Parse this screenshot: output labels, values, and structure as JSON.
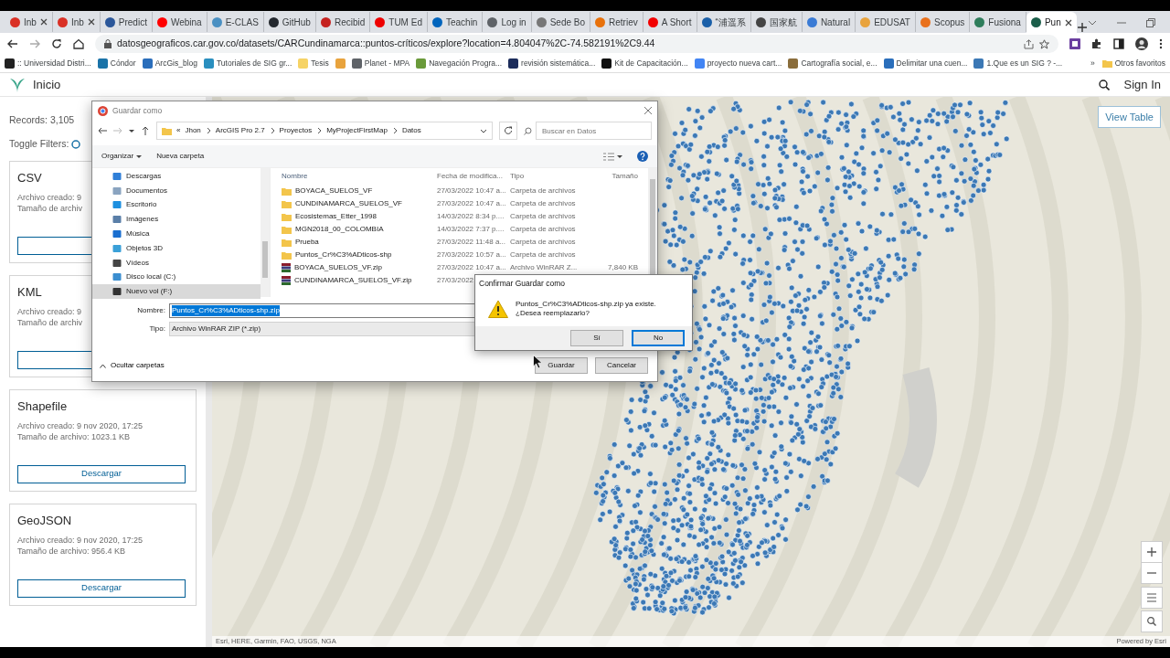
{
  "browser": {
    "tabs": [
      {
        "label": "Inb",
        "color": "#d93025",
        "closable": true,
        "selected": false
      },
      {
        "label": "Inb",
        "color": "#d93025",
        "closable": true,
        "selected": false
      },
      {
        "label": "Predict",
        "color": "#2b579a",
        "closable": false,
        "selected": false
      },
      {
        "label": "Webina",
        "color": "#ff0000",
        "closable": false,
        "selected": false
      },
      {
        "label": "E-CLAS",
        "color": "#4a90c2",
        "closable": false,
        "selected": false
      },
      {
        "label": "GitHub",
        "color": "#24292f",
        "closable": false,
        "selected": false
      },
      {
        "label": "Recibid",
        "color": "#c5221f",
        "closable": false,
        "selected": false
      },
      {
        "label": "TUM Ed",
        "color": "#ee0000",
        "closable": false,
        "selected": false
      },
      {
        "label": "Teachin",
        "color": "#0065bd",
        "closable": false,
        "selected": false
      },
      {
        "label": "Log in",
        "color": "#5f6368",
        "closable": false,
        "selected": false
      },
      {
        "label": "Sede Bo",
        "color": "#777777",
        "closable": false,
        "selected": false
      },
      {
        "label": "Retriev",
        "color": "#e8710a",
        "closable": false,
        "selected": false
      },
      {
        "label": "A Short",
        "color": "#f20000",
        "closable": false,
        "selected": false
      },
      {
        "label": "“浦遥系",
        "color": "#1a5fa8",
        "closable": false,
        "selected": false
      },
      {
        "label": "国家航",
        "color": "#444444",
        "closable": false,
        "selected": false
      },
      {
        "label": "Natural",
        "color": "#3a7bd5",
        "closable": false,
        "selected": false
      },
      {
        "label": "EDUSAT",
        "color": "#e8a33d",
        "closable": false,
        "selected": false
      },
      {
        "label": "Scopus",
        "color": "#e9711c",
        "closable": false,
        "selected": false
      },
      {
        "label": "Fusiona",
        "color": "#2e7d5b",
        "closable": false,
        "selected": false
      },
      {
        "label": "Pun",
        "color": "#1b5e4a",
        "closable": true,
        "selected": true
      }
    ],
    "address": "datosgeograficos.car.gov.co/datasets/CARCundinamarca::puntos-críticos/explore?location=4.804047%2C-74.582191%2C9.44",
    "bookmarks": [
      {
        "label": ":: Universidad Distri...",
        "color": "#222222"
      },
      {
        "label": "Cóndor",
        "color": "#1a73a8"
      },
      {
        "label": "ArcGis_blog",
        "color": "#2a6ebb"
      },
      {
        "label": "Tutoriales de SIG gr...",
        "color": "#2a8fbf"
      },
      {
        "label": "Tesis",
        "color": "#f6d365"
      },
      {
        "color": "#e8a33d"
      },
      {
        "label": "Planet - MPA",
        "color": "#5f6368"
      },
      {
        "label": "Navegación Progra...",
        "color": "#6a9a3a"
      },
      {
        "label": "revisión sistemática...",
        "color": "#1c2c5b"
      },
      {
        "label": "Kit de Capacitación...",
        "color": "#111111"
      },
      {
        "label": "proyecto nueva cart...",
        "color": "#4285f4"
      },
      {
        "label": "Cartografía social, e...",
        "color": "#8a6d3b"
      },
      {
        "label": "Delimitar una cuen...",
        "color": "#2a6ebb"
      },
      {
        "label": "1.Que es un SIG ? -...",
        "color": "#3b78b5"
      }
    ],
    "more": "»",
    "other_bookmarks": "Otros favoritos"
  },
  "site": {
    "title": "Inicio",
    "sign_in": "Sign In"
  },
  "sidebar": {
    "records": "Records: 3,105",
    "toggle_label": "Toggle Filters:",
    "toggle_on": false,
    "downloads": [
      {
        "format": "CSV",
        "lines": [
          "Archivo creado: 9",
          "Tamaño de archiv"
        ]
      },
      {
        "format": "KML",
        "lines": [
          "Archivo creado: 9",
          "Tamaño de archiv"
        ]
      },
      {
        "format": "Shapefile",
        "lines": [
          "Archivo creado: 9 nov 2020, 17:25",
          "Tamaño de archivo: 1023.1 KB"
        ],
        "button": "Descargar"
      },
      {
        "format": "GeoJSON",
        "lines": [
          "Archivo creado: 9 nov 2020, 17:25",
          "Tamaño de archivo: 956.4 KB"
        ],
        "button": "Descargar"
      }
    ]
  },
  "map": {
    "view_table": "View Table",
    "attribution": "Esri, HERE, Garmin, FAO, USGS, NGA",
    "powered": "Powered by Esri"
  },
  "save_dialog": {
    "title": "Guardar como",
    "overflow": "«",
    "path": [
      "Jhon",
      "ArcGIS Pro 2.7",
      "Proyectos",
      "MyProjectFirstMap",
      "Datos"
    ],
    "search_placeholder": "Buscar en Datos",
    "organize": "Organizar",
    "new_folder": "Nueva carpeta",
    "nav": [
      {
        "label": "Descargas",
        "color": "#2f7fd8",
        "selected": false
      },
      {
        "label": "Documentos",
        "color": "#8aa4c0",
        "selected": false
      },
      {
        "label": "Escritorio",
        "color": "#1e90e0",
        "selected": false
      },
      {
        "label": "Imágenes",
        "color": "#5a7fa8",
        "selected": false
      },
      {
        "label": "Música",
        "color": "#1a6fd0",
        "selected": false
      },
      {
        "label": "Objetos 3D",
        "color": "#3aa0d8",
        "selected": false
      },
      {
        "label": "Vídeos",
        "color": "#444444",
        "selected": false
      },
      {
        "label": "Disco local (C:)",
        "color": "#3b8ed0",
        "selected": false
      },
      {
        "label": "Nuevo vol (F:)",
        "color": "#333333",
        "selected": true
      }
    ],
    "columns": [
      "Nombre",
      "Fecha de modifica...",
      "Tipo",
      "Tamaño"
    ],
    "rows": [
      {
        "kind": "folder",
        "name": "BOYACA_SUELOS_VF",
        "date": "27/03/2022 10:47 a...",
        "type": "Carpeta de archivos"
      },
      {
        "kind": "folder",
        "name": "CUNDINAMARCA_SUELOS_VF",
        "date": "27/03/2022 10:47 a...",
        "type": "Carpeta de archivos"
      },
      {
        "kind": "folder",
        "name": "Ecosistemas_Etter_1998",
        "date": "14/03/2022 8:34 p....",
        "type": "Carpeta de archivos"
      },
      {
        "kind": "folder",
        "name": "MGN2018_00_COLOMBIA",
        "date": "14/03/2022 7:37 p....",
        "type": "Carpeta de archivos"
      },
      {
        "kind": "folder",
        "name": "Prueba",
        "date": "27/03/2022 11:48 a...",
        "type": "Carpeta de archivos"
      },
      {
        "kind": "folder",
        "name": "Puntos_Cr%C3%ADticos-shp",
        "date": "27/03/2022 10:57 a...",
        "type": "Carpeta de archivos"
      },
      {
        "kind": "zip",
        "name": "BOYACA_SUELOS_VF.zip",
        "date": "27/03/2022 10:47 a...",
        "type": "Archivo WinRAR Z...",
        "size": "7,840 KB"
      },
      {
        "kind": "zip",
        "name": "CUNDINAMARCA_SUELOS_VF.zip",
        "date": "27/03/2022"
      }
    ],
    "name_label": "Nombre:",
    "name_value": "Puntos_Cr%C3%ADticos-shp.zip",
    "type_label": "Tipo:",
    "type_value": "Archivo WinRAR ZIP (*.zip)",
    "hide_folders": "Ocultar carpetas",
    "buttons": [
      "Guardar",
      "Cancelar"
    ]
  },
  "confirm_dialog": {
    "title": "Confirmar Guardar como",
    "message": "Puntos_Cr%C3%ADticos-shp.zip ya existe.\n¿Desea reemplazarlo?",
    "buttons": [
      {
        "label": "Sí",
        "default": false
      },
      {
        "label": "No",
        "default": true
      }
    ]
  }
}
